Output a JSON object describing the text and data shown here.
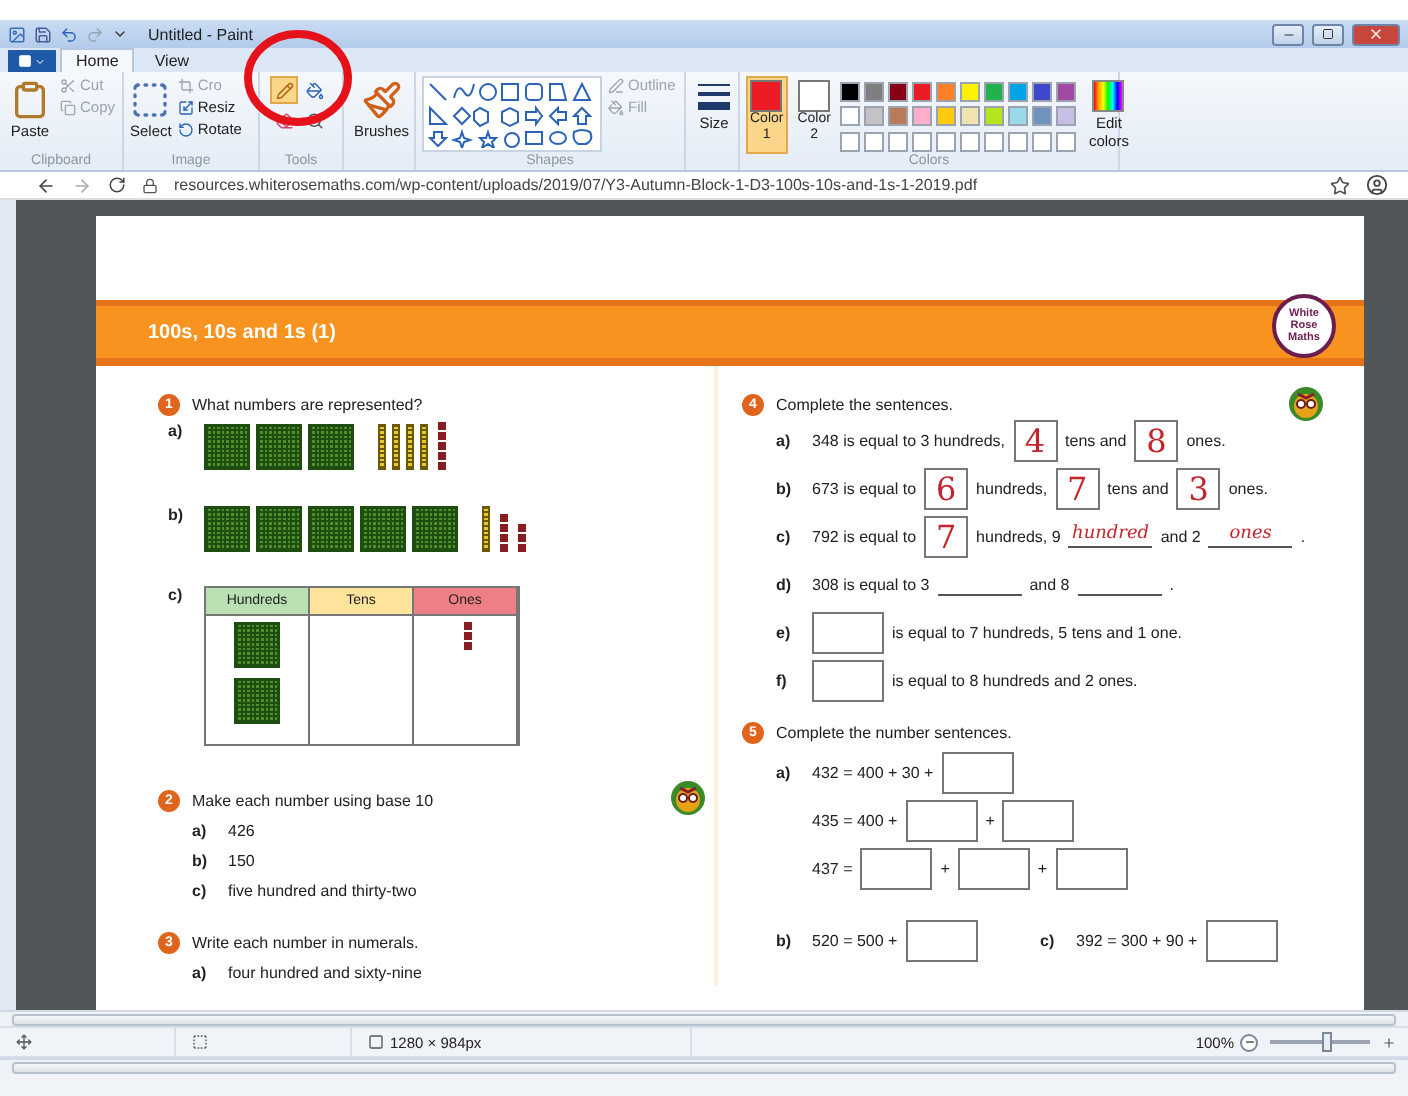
{
  "window": {
    "title": "Untitled - Paint"
  },
  "menu_tabs": [
    {
      "label": "Home",
      "selected": true
    },
    {
      "label": "View",
      "selected": false
    }
  ],
  "ribbon": {
    "clipboard": {
      "paste": "Paste",
      "cut": "Cut",
      "copy": "Copy",
      "label": "Clipboard"
    },
    "image": {
      "select": "Select",
      "crop": "Cro",
      "resize": "Resiz",
      "rotate": "Rotate",
      "label": "Image"
    },
    "tools": {
      "label": "Tools",
      "pencil_selected": true
    },
    "brushes": "Brushes",
    "shapes": {
      "outline": "Outline",
      "fill": "Fill",
      "label": "Shapes"
    },
    "size": "Size",
    "colors": {
      "label": "Colors",
      "edit": "Edit colors",
      "slots": [
        {
          "label": "Color",
          "number": "1",
          "color": "#ed1c24",
          "selected": true
        },
        {
          "label": "Color",
          "number": "2",
          "color": "#ffffff",
          "selected": false
        }
      ],
      "palette": [
        {
          "color": "#000000"
        },
        {
          "color": "#7f7f7f"
        },
        {
          "color": "#880015"
        },
        {
          "color": "#ed1c24"
        },
        {
          "color": "#ff7f27"
        },
        {
          "color": "#fff200"
        },
        {
          "color": "#22b14c"
        },
        {
          "color": "#00a2e8"
        },
        {
          "color": "#3f48cc"
        },
        {
          "color": "#a349a4"
        },
        {
          "color": "#ffffff"
        },
        {
          "color": "#c3c3c3"
        },
        {
          "color": "#b97a57"
        },
        {
          "color": "#ffaec9"
        },
        {
          "color": "#ffc90e"
        },
        {
          "color": "#efe4b0"
        },
        {
          "color": "#b5e61d"
        },
        {
          "color": "#99d9ea"
        },
        {
          "color": "#7092be"
        },
        {
          "color": "#c8bfe7"
        }
      ]
    }
  },
  "browser": {
    "url": "resources.whiterosemaths.com/wp-content/uploads/2019/07/Y3-Autumn-Block-1-D3-100s-10s-and-1s-1-2019.pdf"
  },
  "worksheet": {
    "title": "100s, 10s and 1s (1)",
    "logo": [
      "White",
      "Rose",
      "Maths"
    ],
    "q1": {
      "number": "1",
      "prompt": "What numbers are represented?",
      "items": [
        {
          "label": "a)",
          "kind": "blocks"
        },
        {
          "label": "b)",
          "kind": "blocks"
        },
        {
          "label": "c)",
          "kind": "table",
          "columns": [
            {
              "label": "Hundreds",
              "color": "#b9dfb3"
            },
            {
              "label": "Tens",
              "color": "#fde49a"
            },
            {
              "label": "Ones",
              "color": "#ef7f86"
            }
          ]
        }
      ]
    },
    "q2": {
      "number": "2",
      "prompt": "Make each number using base 10",
      "items": [
        {
          "label": "a)",
          "text": "426"
        },
        {
          "label": "b)",
          "text": "150"
        },
        {
          "label": "c)",
          "text": "five hundred and thirty-two"
        }
      ]
    },
    "q3": {
      "number": "3",
      "prompt": "Write each number in numerals.",
      "items": [
        {
          "label": "a)",
          "text": "four hundred and sixty-nine"
        }
      ]
    },
    "q4": {
      "number": "4",
      "prompt": "Complete the sentences.",
      "items": [
        {
          "label": "a)",
          "parts": [
            {
              "kind": "text",
              "text": "348 is equal to 3 hundreds,"
            },
            {
              "kind": "box",
              "value": "4"
            },
            {
              "kind": "text",
              "text": "tens and"
            },
            {
              "kind": "box",
              "value": "8"
            },
            {
              "kind": "text",
              "text": "ones."
            }
          ]
        },
        {
          "label": "b)",
          "parts": [
            {
              "kind": "text",
              "text": "673 is equal to"
            },
            {
              "kind": "box",
              "value": "6"
            },
            {
              "kind": "text",
              "text": "hundreds,"
            },
            {
              "kind": "box",
              "value": "7"
            },
            {
              "kind": "text",
              "text": "tens and"
            },
            {
              "kind": "box",
              "value": "3"
            },
            {
              "kind": "text",
              "text": "ones."
            }
          ]
        },
        {
          "label": "c)",
          "parts": [
            {
              "kind": "text",
              "text": "792 is equal to"
            },
            {
              "kind": "box",
              "value": "7"
            },
            {
              "kind": "text",
              "text": "hundreds, 9"
            },
            {
              "kind": "line",
              "value": "hundred"
            },
            {
              "kind": "text",
              "text": "and 2"
            },
            {
              "kind": "line",
              "value": "ones"
            },
            {
              "kind": "text",
              "text": "."
            }
          ]
        },
        {
          "label": "d)",
          "parts": [
            {
              "kind": "text",
              "text": "308 is equal to 3"
            },
            {
              "kind": "line"
            },
            {
              "kind": "text",
              "text": "and 8"
            },
            {
              "kind": "line"
            },
            {
              "kind": "text",
              "text": "."
            }
          ]
        },
        {
          "label": "e)",
          "parts": [
            {
              "kind": "box"
            },
            {
              "kind": "text",
              "text": "is equal to 7 hundreds, 5 tens and 1 one."
            }
          ]
        },
        {
          "label": "f)",
          "parts": [
            {
              "kind": "box"
            },
            {
              "kind": "text",
              "text": "is equal to 8 hundreds and 2 ones."
            }
          ]
        }
      ]
    },
    "q5": {
      "number": "5",
      "prompt": "Complete the number sentences.",
      "rows": [
        {
          "cells": [
            {
              "label": "a)",
              "parts": [
                {
                  "kind": "text",
                  "text": "432 = 400 + 30 +"
                },
                {
                  "kind": "box"
                }
              ]
            }
          ]
        },
        {
          "cells": [
            {
              "parts": [
                {
                  "kind": "text",
                  "text": "435 = 400 +"
                },
                {
                  "kind": "box"
                },
                {
                  "kind": "text",
                  "text": "+"
                },
                {
                  "kind": "box"
                }
              ]
            }
          ]
        },
        {
          "cells": [
            {
              "parts": [
                {
                  "kind": "text",
                  "text": "437 ="
                },
                {
                  "kind": "box"
                },
                {
                  "kind": "text",
                  "text": "+"
                },
                {
                  "kind": "box"
                },
                {
                  "kind": "text",
                  "text": "+"
                },
                {
                  "kind": "box"
                }
              ]
            }
          ]
        },
        {
          "cells": [
            {
              "label": "b)",
              "parts": [
                {
                  "kind": "text",
                  "text": "520 = 500 +"
                },
                {
                  "kind": "box"
                }
              ]
            },
            {
              "label": "c)",
              "parts": [
                {
                  "kind": "text",
                  "text": "392 = 300 + 90 +"
                },
                {
                  "kind": "box"
                }
              ]
            }
          ]
        }
      ]
    }
  },
  "status_bar": {
    "canvas_size": "1280 × 984px",
    "zoom": "100%",
    "zoom_slider": {
      "level": 0.55
    }
  }
}
